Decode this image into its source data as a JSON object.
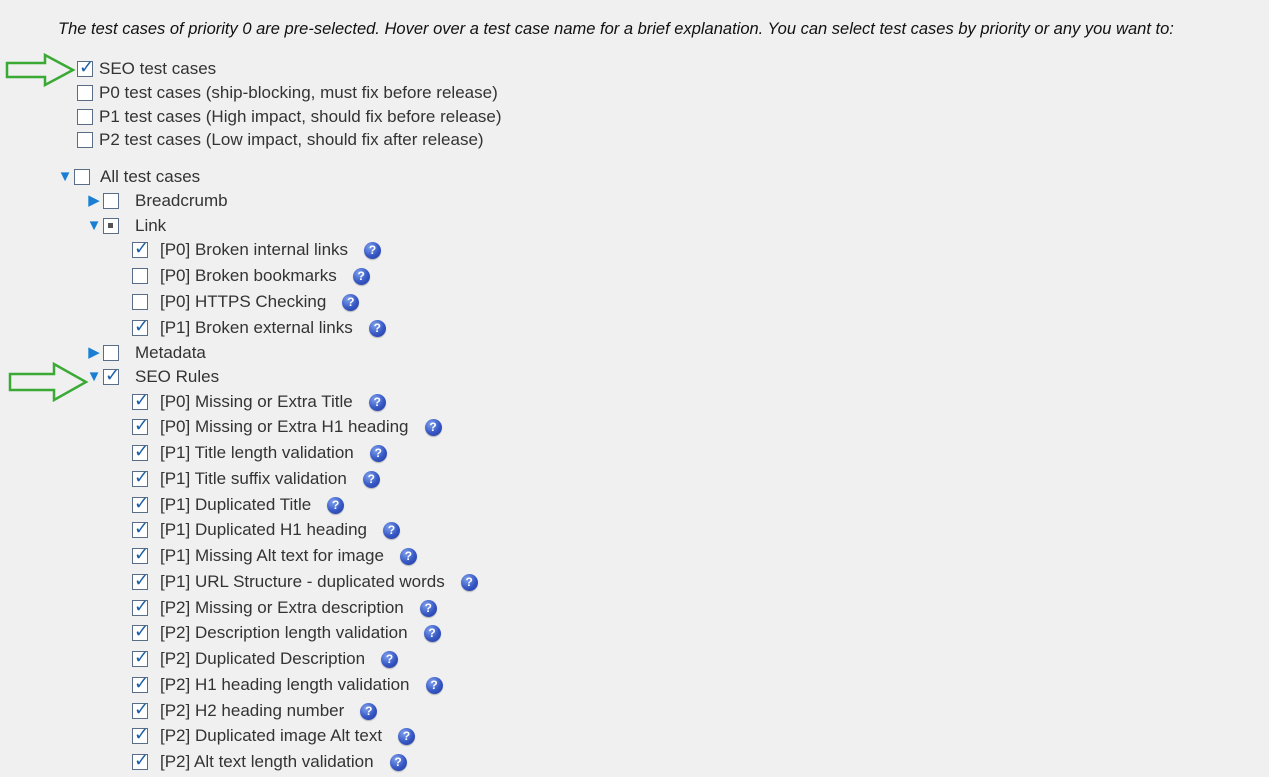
{
  "intro_text": "The test cases of priority 0 are pre-selected. Hover over a test case name for a brief explanation. You can select test cases by priority or any you want to:",
  "priority_options": [
    {
      "label": "SEO test cases",
      "checked": true
    },
    {
      "label": "P0 test cases (ship-blocking, must fix before release)",
      "checked": false
    },
    {
      "label": "P1 test cases (High impact, should fix before release)",
      "checked": false
    },
    {
      "label": "P2 test cases (Low impact, should fix after release)",
      "checked": false
    }
  ],
  "tree": {
    "root": {
      "label": "All test cases",
      "expanded": true,
      "checked": false
    },
    "groups": [
      {
        "label": "Breadcrumb",
        "expanded": false,
        "state": "unchecked",
        "items": []
      },
      {
        "label": "Link",
        "expanded": true,
        "state": "partial",
        "items": [
          {
            "label": "[P0] Broken internal links",
            "checked": true
          },
          {
            "label": "[P0] Broken bookmarks",
            "checked": false
          },
          {
            "label": "[P0] HTTPS Checking",
            "checked": false
          },
          {
            "label": "[P1] Broken external links",
            "checked": true
          }
        ]
      },
      {
        "label": "Metadata",
        "expanded": false,
        "state": "unchecked",
        "items": []
      },
      {
        "label": "SEO Rules",
        "expanded": true,
        "state": "checked",
        "items": [
          {
            "label": "[P0] Missing or Extra Title",
            "checked": true
          },
          {
            "label": "[P0] Missing or Extra H1 heading",
            "checked": true
          },
          {
            "label": "[P1] Title length validation",
            "checked": true
          },
          {
            "label": "[P1] Title suffix validation",
            "checked": true
          },
          {
            "label": "[P1] Duplicated Title",
            "checked": true
          },
          {
            "label": "[P1] Duplicated H1 heading",
            "checked": true
          },
          {
            "label": "[P1] Missing Alt text for image",
            "checked": true
          },
          {
            "label": "[P1] URL Structure - duplicated words",
            "checked": true
          },
          {
            "label": "[P2] Missing or Extra description",
            "checked": true
          },
          {
            "label": "[P2] Description length validation",
            "checked": true
          },
          {
            "label": "[P2] Duplicated Description",
            "checked": true
          },
          {
            "label": "[P2] H1 heading length validation",
            "checked": true
          },
          {
            "label": "[P2] H2 heading number",
            "checked": true
          },
          {
            "label": "[P2] Duplicated image Alt text",
            "checked": true
          },
          {
            "label": "[P2] Alt text length validation",
            "checked": true
          }
        ]
      }
    ]
  },
  "help_glyph": "?",
  "check_glyph": "✓",
  "expanded_glyph": "▼",
  "collapsed_glyph": "▶",
  "colors": {
    "accent": "#1a7fd4",
    "check": "#1b5fa8",
    "callout_arrow": "#3aaa35",
    "background": "#f0f0f0"
  },
  "icons": {
    "help": "question-circle-icon",
    "callout": "green-outline-arrow-icon"
  }
}
